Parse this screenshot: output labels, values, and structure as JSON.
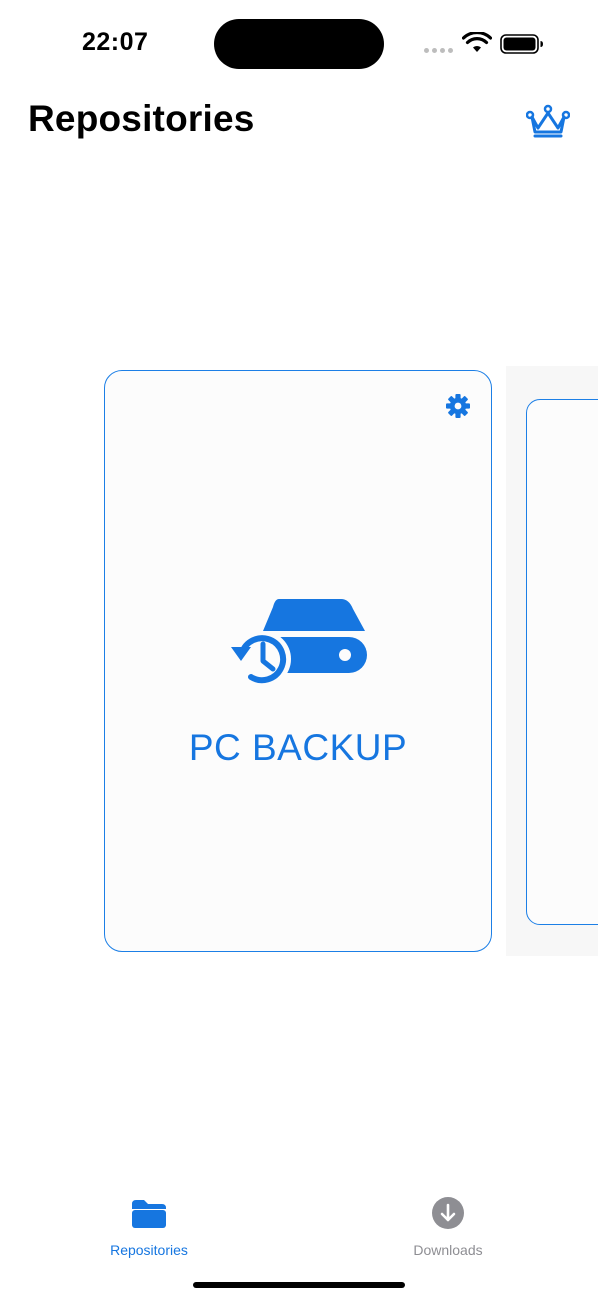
{
  "status_bar": {
    "time": "22:07"
  },
  "header": {
    "title": "Repositories",
    "premium_icon": "crown-icon"
  },
  "repositories": [
    {
      "name": "PC BACKUP",
      "icon": "backup-drive-icon",
      "settings_icon": "gear-icon"
    }
  ],
  "tab_bar": {
    "tabs": [
      {
        "label": "Repositories",
        "icon": "folder-icon",
        "selected": true
      },
      {
        "label": "Downloads",
        "icon": "download-circle-icon",
        "selected": false
      }
    ]
  },
  "colors": {
    "accent": "#1676e0",
    "card_border": "#1c7fe6",
    "inactive": "#8e8e93"
  }
}
